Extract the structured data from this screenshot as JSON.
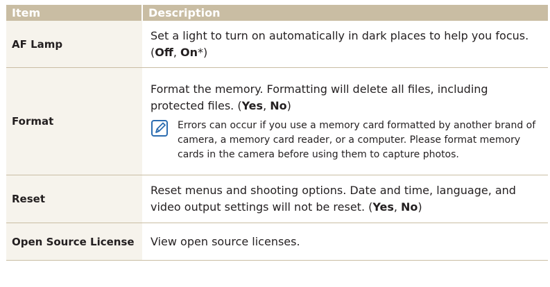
{
  "header": {
    "item": "Item",
    "description": "Description"
  },
  "rows": [
    {
      "item": "AF Lamp",
      "desc_text": "Set a light to turn on automatically in dark places to help you focus. (",
      "opt1": "Off",
      "sep1": ", ",
      "opt2": "On",
      "tail": "*)"
    },
    {
      "item": "Format",
      "desc_text": "Format the memory. Formatting will delete all files, including protected files. (",
      "opt1": "Yes",
      "sep1": ", ",
      "opt2": "No",
      "tail": ")",
      "note": "Errors can occur if you use a memory card formatted by another brand of camera, a memory card reader, or a computer. Please format memory cards in the camera before using them to capture photos.",
      "note_icon": "note-pencil-icon"
    },
    {
      "item": "Reset",
      "desc_text": "Reset menus and shooting options. Date and time, language, and video output settings will not be reset. (",
      "opt1": "Yes",
      "sep1": ", ",
      "opt2": "No",
      "tail": ")"
    },
    {
      "item": "Open Source License",
      "desc_text": "View open source licenses."
    }
  ],
  "colors": {
    "header_bg": "#c9bda3",
    "item_bg": "#f6f3ec",
    "rule": "#c9bda3",
    "icon": "#2b6cb0"
  }
}
